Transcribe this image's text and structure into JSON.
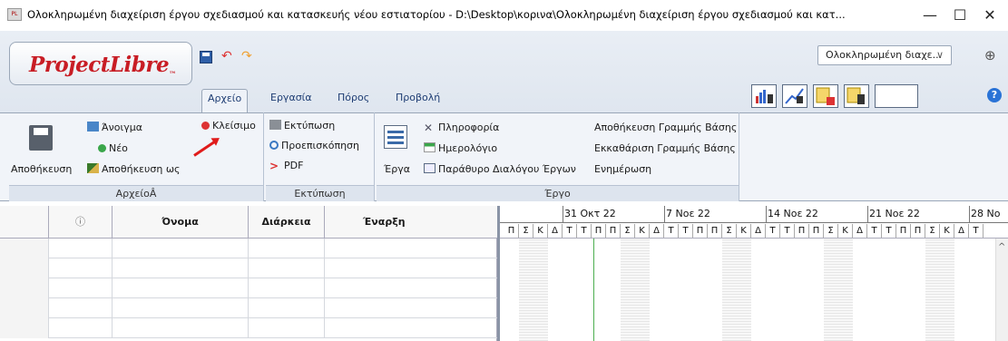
{
  "window": {
    "title": "Ολοκληρωμένη διαχείριση έργου σχεδιασμού και κατασκευής νέου εστιατορίου - D:\\Desktop\\κορινα\\Ολοκληρωμένη διαχείριση έργου σχεδιασμού και κατ...",
    "minimize": "—",
    "maximize": "☐",
    "close": "✕"
  },
  "logo": {
    "text": "ProjectLibre",
    "tm": "™"
  },
  "tabs": [
    {
      "label": "Αρχείο",
      "active": true
    },
    {
      "label": "Εργασία"
    },
    {
      "label": "Πόρος"
    },
    {
      "label": "Προβολή"
    }
  ],
  "project_selector": {
    "value": "Ολοκληρωμένη διαχε...",
    "chevron": "∨"
  },
  "icons": {
    "globe": "globe-icon",
    "help": "help-icon"
  },
  "help_glyph": "?",
  "globe_glyph": "⊕",
  "ribbon": {
    "file_group": {
      "label": "ΑρχείοÂ",
      "save": "Αποθήκευση",
      "open": "Άνοιγμα",
      "new": "Νέο",
      "save_as": "Αποθήκευση ως",
      "close": "Κλείσιμο"
    },
    "print_group": {
      "label": "Εκτύπωση",
      "print": "Εκτύπωση",
      "preview": "Προεπισκόπηση",
      "pdf": "PDF"
    },
    "project_group": {
      "label": "Έργο",
      "projects": "Έργα",
      "info": "Πληροφορία",
      "calendar": "Ημερολόγιο",
      "projects_dialog": "Παράθυρο Διαλόγου Έργων",
      "save_baseline": "Αποθήκευση Γραμμής Βάσης",
      "clear_baseline": "Εκκαθάριση Γραμμής Βάσης",
      "update": "Ενημέρωση"
    }
  },
  "table": {
    "columns": [
      "",
      "ⓘ",
      "Όνομα",
      "Διάρκεια",
      "Έναρξη"
    ],
    "row_count": 6
  },
  "gantt": {
    "weeks": [
      "31 Οκτ 22",
      "7 Νοε 22",
      "14 Νοε 22",
      "21 Νοε 22",
      "28 Νο"
    ],
    "days": [
      "Π",
      "Σ",
      "Κ",
      "Δ",
      "Τ",
      "Τ",
      "Π",
      "Π",
      "Σ",
      "Κ",
      "Δ",
      "Τ",
      "Τ",
      "Π",
      "Π",
      "Σ",
      "Κ",
      "Δ",
      "Τ",
      "Τ",
      "Π",
      "Π",
      "Σ",
      "Κ",
      "Δ",
      "Τ",
      "Τ",
      "Π",
      "Π",
      "Σ",
      "Κ",
      "Δ",
      "Τ"
    ],
    "scroll_up": "^"
  },
  "colors": {
    "accent": "#1e3d73",
    "logo_red": "#c81d25",
    "today_line": "#4caf50",
    "annotation_arrow": "#e01b1b"
  }
}
